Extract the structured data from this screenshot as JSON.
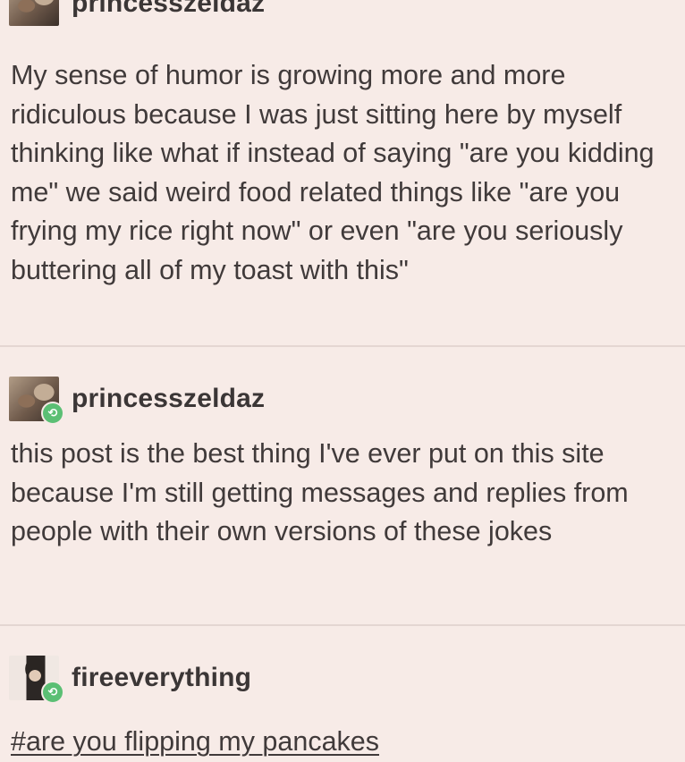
{
  "posts": [
    {
      "username": "princesszeldaz",
      "avatar_icon": "user-avatar-icon",
      "reblog": false,
      "text": "My sense of humor is growing more and more ridiculous because I was just sitting here by myself thinking like what if instead of saying \"are you kidding me\" we said weird food related things like \"are you frying my rice right now\" or even \"are you seriously buttering all of my toast with this\""
    },
    {
      "username": "princesszeldaz",
      "avatar_icon": "user-avatar-icon",
      "reblog": true,
      "reblog_icon": "reblog-icon",
      "text": "this post is the best thing I've ever put on this site because I'm still getting messages and replies from people with their own versions of these jokes"
    },
    {
      "username": "fireeverything",
      "avatar_icon": "user-avatar-icon",
      "reblog": true,
      "reblog_icon": "reblog-icon",
      "tag": "#are you flipping my pancakes"
    }
  ],
  "colors": {
    "background": "#f7ebe7",
    "text": "#403a3a",
    "divider": "#e4d6d2",
    "reblog_badge": "#5bbf74"
  }
}
